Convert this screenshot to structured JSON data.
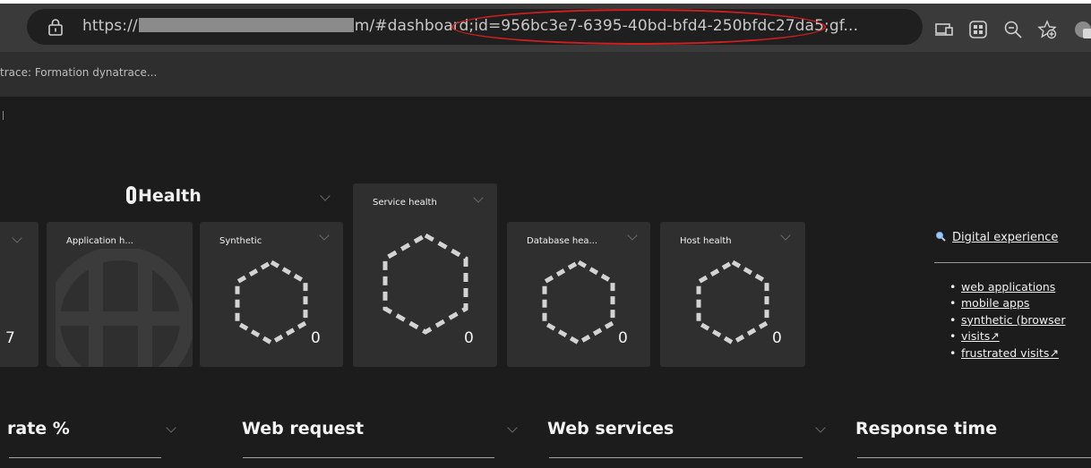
{
  "browser": {
    "url_prefix": "https://",
    "url_path": "m/#dashboard;id=956bc3e7-6395-40bd-bfd4-250bfdc27da5;gf...",
    "icons": [
      "lock-icon",
      "immersive-reader-icon",
      "collections-icon",
      "zoom-out-icon",
      "add-favorite-icon",
      "extension-icon"
    ]
  },
  "tab": {
    "title": "trace: Formation dynatrace..."
  },
  "health": {
    "title": "Health"
  },
  "tiles": [
    {
      "title": "",
      "count": "7"
    },
    {
      "title": "Application h...",
      "count": ""
    },
    {
      "title": "Synthetic",
      "count": "0"
    },
    {
      "title": "Service health",
      "count": "0"
    },
    {
      "title": "Database hea...",
      "count": "0"
    },
    {
      "title": "Host health",
      "count": "0"
    }
  ],
  "digital_experience": {
    "title": "Digital experience",
    "links": [
      "web applications",
      "mobile apps",
      "synthetic (browser",
      "visits↗",
      "frustrated visits↗"
    ]
  },
  "sections": [
    {
      "title": "rate %"
    },
    {
      "title": "Web request"
    },
    {
      "title": "Web services"
    },
    {
      "title": "Response time"
    }
  ],
  "colors": {
    "background": "#1c1c1c",
    "tile": "#2f2f2f",
    "annotation": "#d21e1e"
  }
}
